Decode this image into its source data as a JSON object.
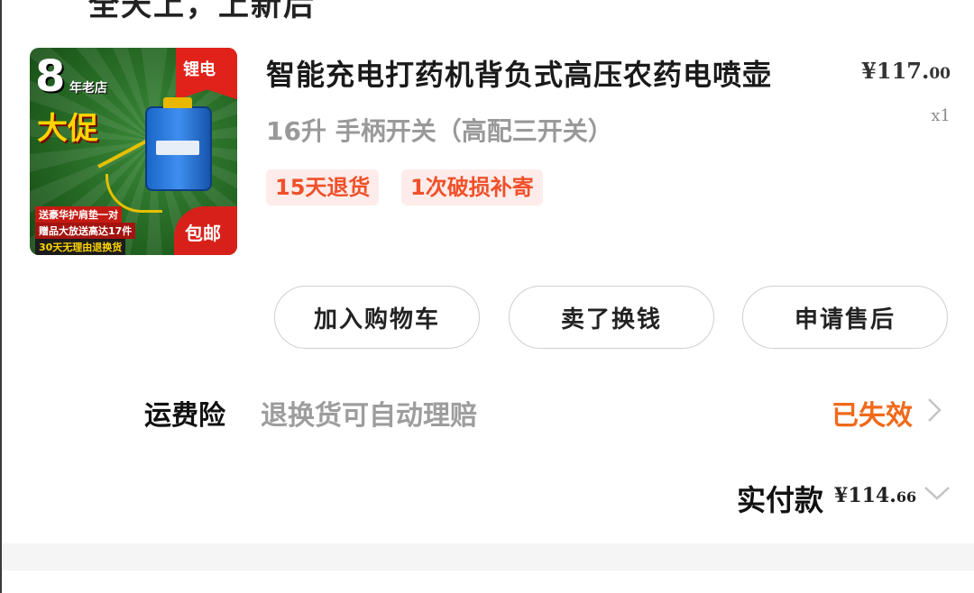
{
  "header": {
    "partial_text": "全天上，上新后"
  },
  "product": {
    "thumbnail": {
      "badge_number": "8",
      "badge_shop": "年老店",
      "badge_sale": "大促",
      "ribbon": "锂电",
      "promo_lines": [
        "送豪华护肩垫一对",
        "赠品大放送高达17件",
        "30天无理由退换货"
      ],
      "free_shipping": "包邮"
    },
    "title": "智能充电打药机背负式高压农药电喷壶",
    "price_symbol": "¥",
    "price_int": "117.",
    "price_dec": "00",
    "quantity": "x1",
    "spec": "16升 手柄开关（高配三开关）",
    "tags": [
      "15天退货",
      "1次破损补寄"
    ]
  },
  "actions": {
    "add_to_cart": "加入购物车",
    "resell": "卖了换钱",
    "after_sales": "申请售后"
  },
  "insurance": {
    "label": "运费险",
    "description": "退换货可自动理赔",
    "status": "已失效",
    "status_color": "#f06a1a"
  },
  "payment": {
    "label": "实付款",
    "symbol": "¥",
    "amount_int": "114.",
    "amount_dec": "66"
  }
}
